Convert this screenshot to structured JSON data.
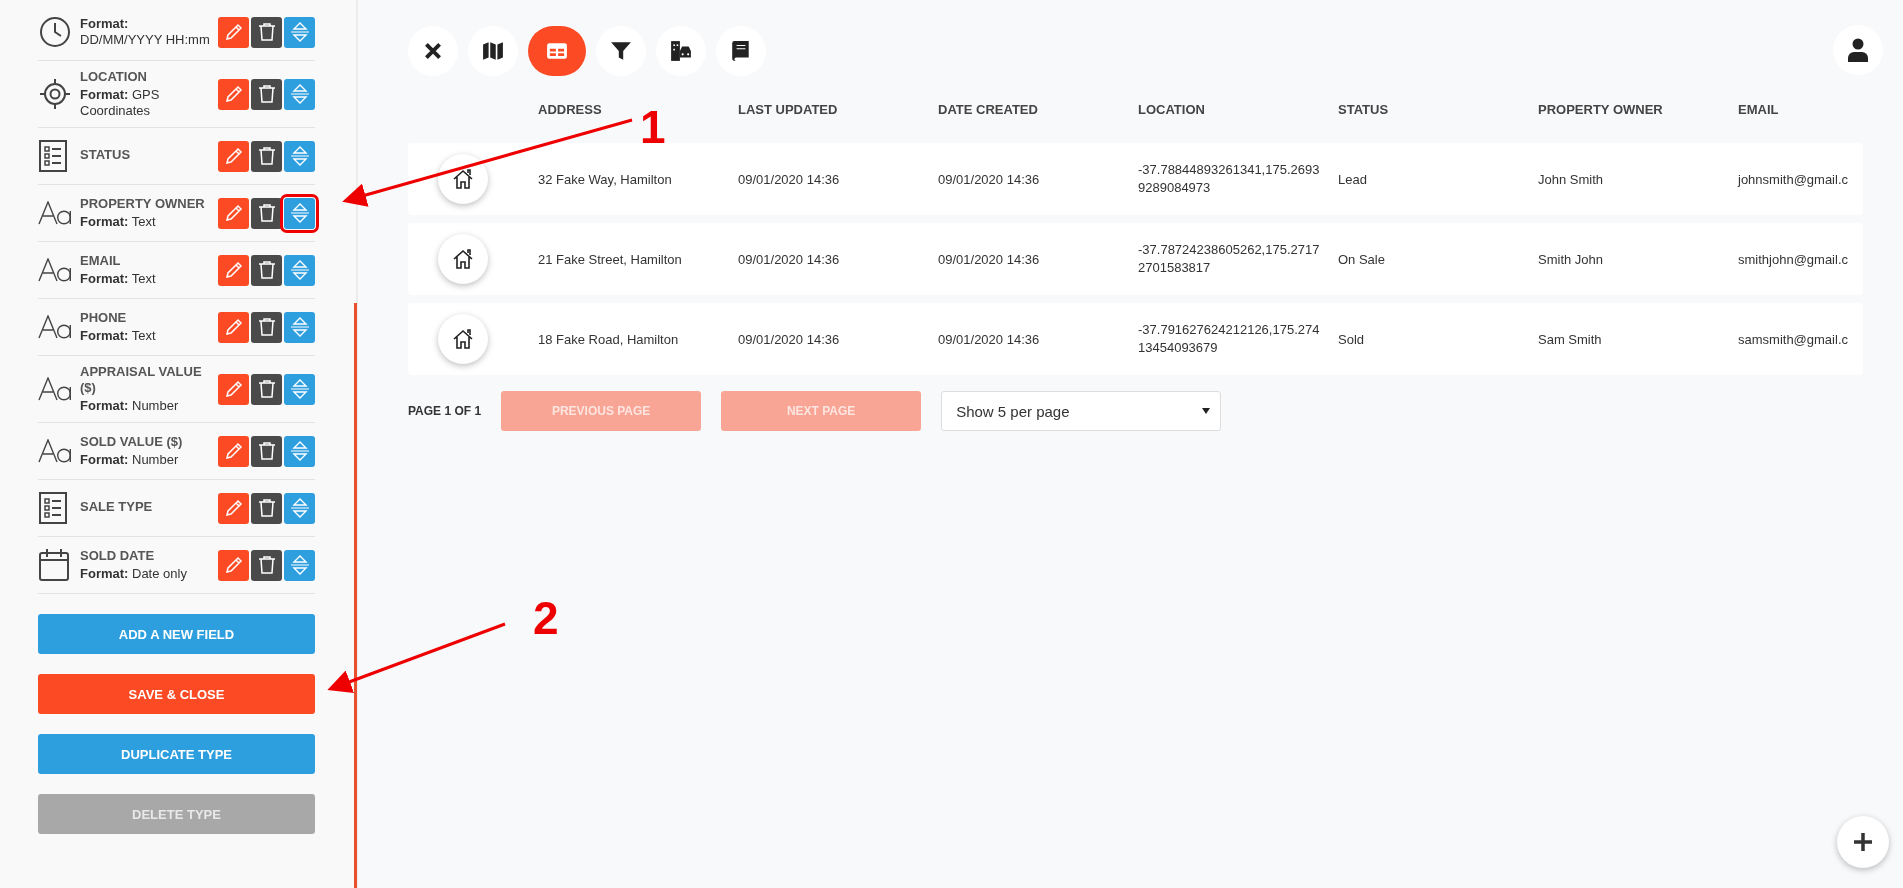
{
  "sidebar": {
    "fields": [
      {
        "kind": "clock",
        "format": "**Format:** DD/MM/YYYY HH:mm",
        "marked": false
      },
      {
        "kind": "location",
        "label": "LOCATION",
        "format": "**Format:** GPS Coordinates",
        "marked": false
      },
      {
        "kind": "list",
        "label": "STATUS",
        "marked": false
      },
      {
        "kind": "text",
        "label": "PROPERTY OWNER",
        "format": "**Format:** Text",
        "marked": true
      },
      {
        "kind": "text",
        "label": "EMAIL",
        "format": "**Format:** Text",
        "marked": false
      },
      {
        "kind": "text",
        "label": "PHONE",
        "format": "**Format:** Text",
        "marked": false
      },
      {
        "kind": "text",
        "label": "APPRAISAL VALUE ($)",
        "format": "**Format:** Number",
        "marked": false
      },
      {
        "kind": "text",
        "label": "SOLD VALUE ($)",
        "format": "**Format:** Number",
        "marked": false
      },
      {
        "kind": "list",
        "label": "SALE TYPE",
        "marked": false
      },
      {
        "kind": "date",
        "label": "SOLD DATE",
        "format": "**Format:** Date only",
        "marked": false
      }
    ],
    "buttons": [
      {
        "label": "ADD A NEW FIELD",
        "kind": "primary"
      },
      {
        "label": "SAVE & CLOSE",
        "kind": "accent"
      },
      {
        "label": "DUPLICATE TYPE",
        "kind": "primary"
      },
      {
        "label": "DELETE TYPE",
        "kind": "disabled"
      }
    ]
  },
  "toolbar": [
    {
      "selected": false
    },
    {
      "selected": false
    },
    {
      "selected": true
    },
    {
      "selected": false
    },
    {
      "selected": false
    },
    {
      "selected": false
    }
  ],
  "table": {
    "columns": [
      "ADDRESS",
      "LAST UPDATED",
      "DATE CREATED",
      "LOCATION",
      "STATUS",
      "PROPERTY OWNER",
      "EMAIL"
    ],
    "rows": [
      [
        "32 Fake Way, Hamilton",
        "09/01/2020 14:36",
        "09/01/2020 14:36",
        "-37.78844893261341,175.26939289084973",
        "Lead",
        "John Smith",
        "johnsmith@gmail.c"
      ],
      [
        "21 Fake Street, Hamilton",
        "09/01/2020 14:36",
        "09/01/2020 14:36",
        "-37.78724238605262,175.27172701583817",
        "On Sale",
        "Smith John",
        "smithjohn@gmail.c"
      ],
      [
        "18 Fake Road, Hamilton",
        "09/01/2020 14:36",
        "09/01/2020 14:36",
        "-37.791627624212126,175.27413454093679",
        "Sold",
        "Sam Smith",
        "samsmith@gmail.c"
      ]
    ]
  },
  "pagination": {
    "page": "PAGE 1 OF 1",
    "previous": {
      "label": "PREVIOUS PAGE",
      "disabled": true
    },
    "next": {
      "label": "NEXT PAGE",
      "disabled": true
    },
    "per_page": "Show 5 per page"
  },
  "annotations": [
    "1",
    "2"
  ]
}
